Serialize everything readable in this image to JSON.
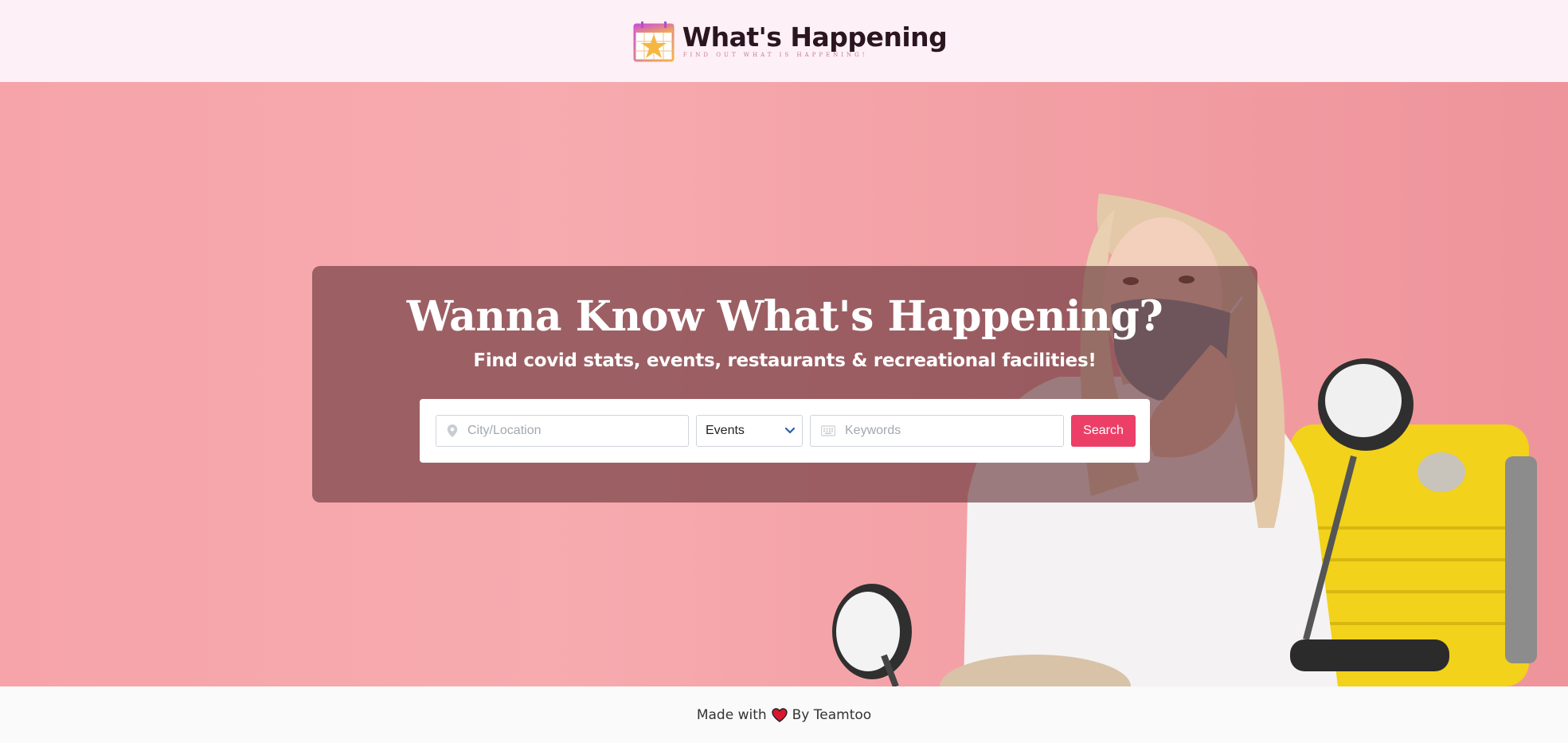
{
  "header": {
    "logo_title": "What's Happening",
    "logo_tagline": "FIND OUT WHAT IS HAPPENING!",
    "logo_icon": "calendar-star-icon"
  },
  "hero": {
    "title": "Wanna Know What's Happening?",
    "subtitle": "Find covid stats, events, restaurants & recreational facilities!",
    "background_color": "#f6a4a9"
  },
  "search": {
    "location_placeholder": "City/Location",
    "location_value": "",
    "location_icon": "map-pin-icon",
    "category_selected": "Events",
    "category_icon": "chevron-down-icon",
    "keywords_placeholder": "Keywords",
    "keywords_value": "",
    "keywords_icon": "keyboard-icon",
    "button_label": "Search",
    "button_color": "#ec3f68"
  },
  "footer": {
    "prefix": "Made with",
    "suffix": "By Teamtoo",
    "heart_icon": "heart-icon"
  }
}
